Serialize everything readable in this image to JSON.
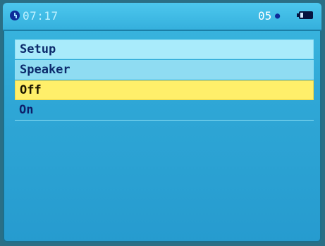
{
  "statusbar": {
    "time": "07:17",
    "volume": "05",
    "icons": {
      "clock": "clock-icon",
      "speaker": "speaker-icon",
      "battery": "battery-icon"
    }
  },
  "menu": {
    "title": "Setup",
    "subtitle": "Speaker",
    "options": [
      {
        "label": "Off",
        "selected": true
      },
      {
        "label": "On",
        "selected": false
      }
    ]
  },
  "colors": {
    "background": "#2fa7d6",
    "highlight": "#ffef6a",
    "text": "#0c2a6b"
  }
}
